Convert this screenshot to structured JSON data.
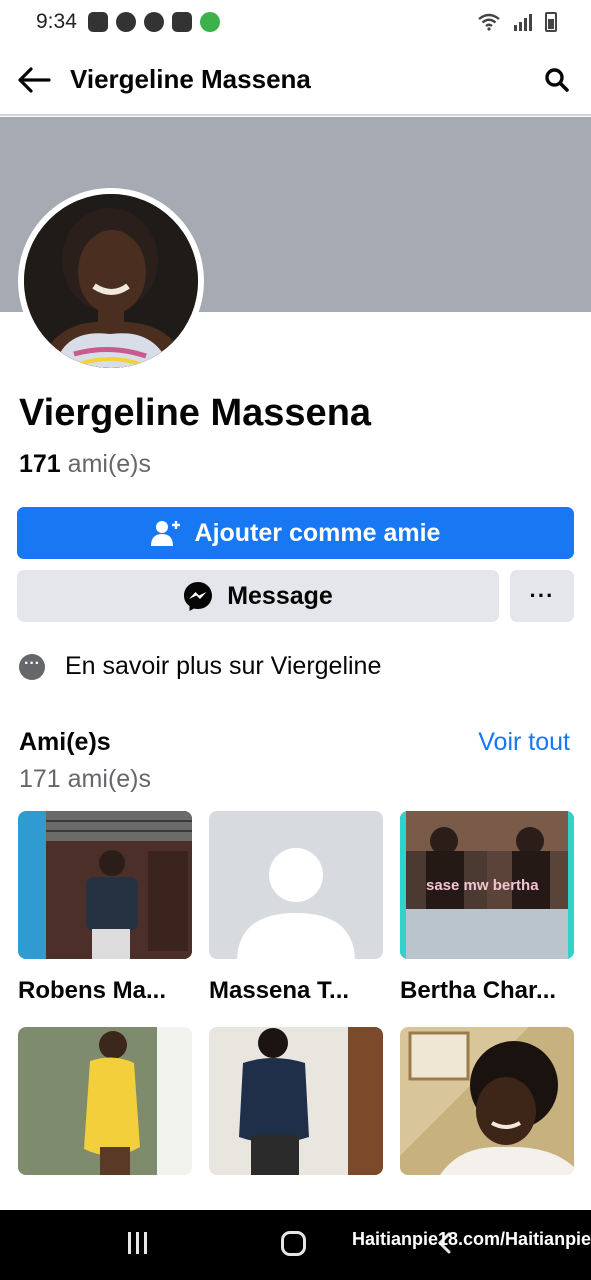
{
  "status_bar": {
    "time": "9:34"
  },
  "header": {
    "title": "Viergeline Massena",
    "back_icon": "arrow-left-icon",
    "search_icon": "search-icon"
  },
  "profile": {
    "name": "Viergeline Massena",
    "friend_count": "171",
    "friend_label": "ami(e)s"
  },
  "actions": {
    "add_friend": "Ajouter comme amie",
    "message": "Message",
    "more": "···"
  },
  "about": {
    "label": "En savoir plus sur Viergeline"
  },
  "friends_section": {
    "title": "Ami(e)s",
    "see_all": "Voir tout",
    "subtitle": "171 ami(e)s",
    "friends": [
      {
        "name": "Robens Ma..."
      },
      {
        "name": "Massena T..."
      },
      {
        "name": "Bertha Char..."
      },
      {
        "name": ""
      },
      {
        "name": ""
      },
      {
        "name": ""
      }
    ],
    "photo_caption": "sase mw bertha"
  },
  "watermark": "Haitianpie18.com/Haitianpie",
  "colors": {
    "accent": "#1877f2",
    "cover": "#a6abb3",
    "secondary_button": "#e4e6eb",
    "muted_text": "#65676b"
  }
}
